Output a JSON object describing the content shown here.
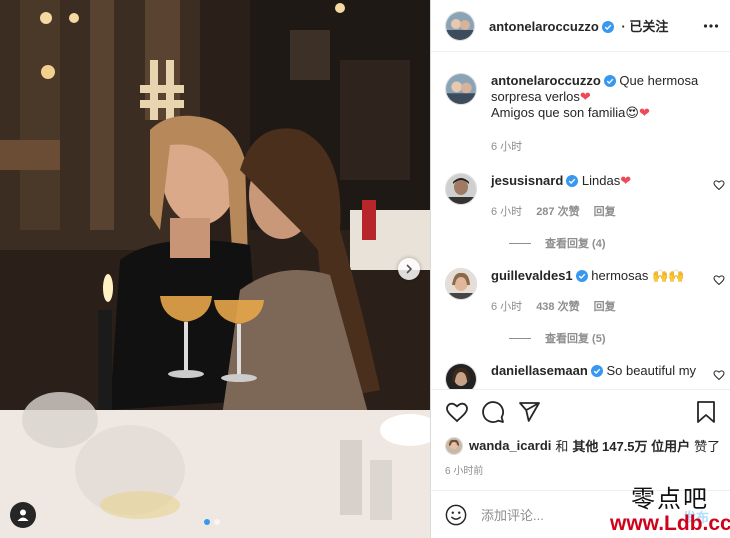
{
  "post": {
    "author": "antonelaroccuzzo",
    "follow_state": "· 已关注",
    "caption_line1": "Que hermosa sorpresa verlos",
    "caption_line2": "Amigos que son familia",
    "caption_time": "6 小时"
  },
  "comments": [
    {
      "user": "jesusisnard",
      "text": "Lindas",
      "time": "6 小时",
      "likes": "287 次赞",
      "reply": "回复",
      "view_replies": "查看回复 (4)"
    },
    {
      "user": "guillevaldes1",
      "text": "hermosas 🙌🙌",
      "time": "6 小时",
      "likes": "438 次赞",
      "reply": "回复",
      "view_replies": "查看回复 (5)"
    },
    {
      "user": "daniellasemaan",
      "text": "So beautiful my"
    }
  ],
  "likes": {
    "first_user": "wanda_icardi",
    "text_and": "和",
    "text_others": "其他 147.5万 位用户",
    "text_liked": "赞了"
  },
  "time_ago": "6 小时前",
  "add_comment": {
    "placeholder": "添加评论...",
    "post_label": "发布"
  },
  "icons": [
    "more-icon",
    "verified-icon",
    "heart-icon",
    "comment-icon",
    "share-icon",
    "bookmark-icon",
    "emoji-icon",
    "tag-user-icon",
    "chevron-right-icon"
  ],
  "colors": {
    "verified": "#3897f0",
    "heart_red": "#ed4956",
    "link_blue": "#b2dffc",
    "muted": "#8e8e8e"
  },
  "carousel": {
    "slides": 2,
    "active": 1
  },
  "watermark": {
    "chinese": "零点吧",
    "url": "www.Ldb.cc"
  }
}
